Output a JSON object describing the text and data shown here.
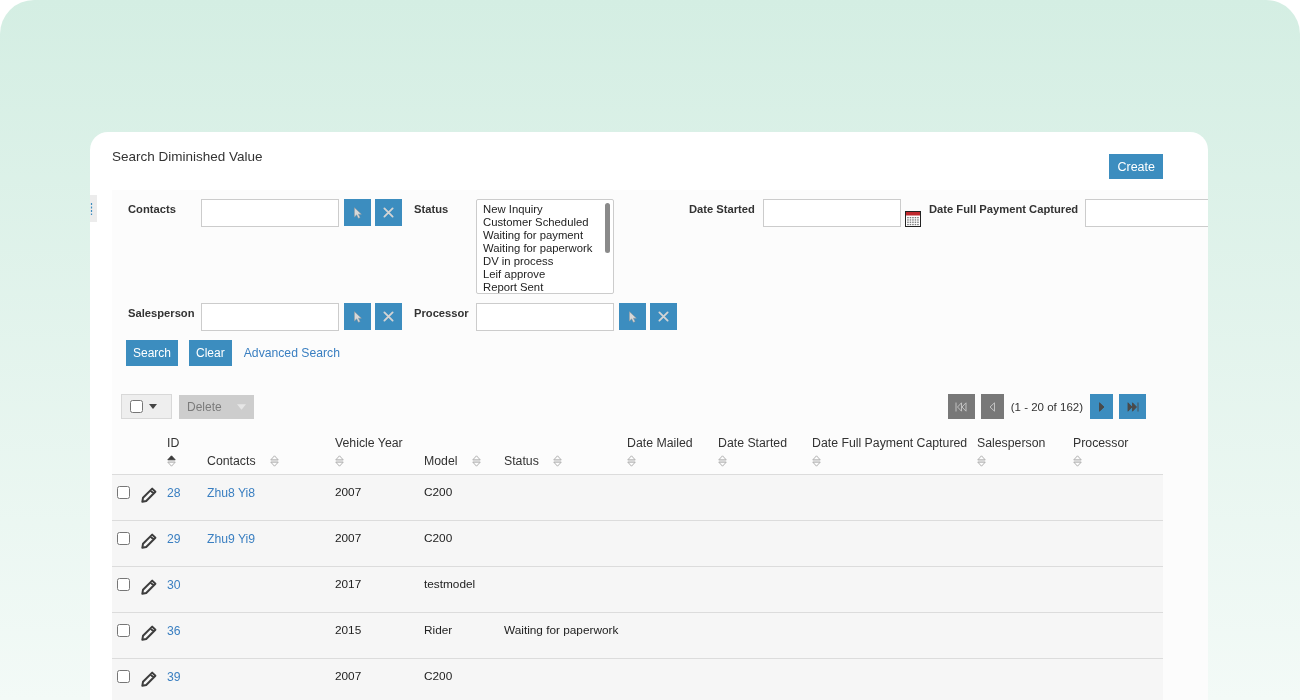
{
  "page": {
    "title": "Search Diminished Value",
    "create_button": {
      "label": "Create"
    }
  },
  "search_form": {
    "fields": [
      {
        "kind": "lookup",
        "label": "Contacts"
      },
      {
        "kind": "listbox",
        "label": "Status",
        "options": [
          {
            "label": "New Inquiry",
            "selected": false
          },
          {
            "label": "Customer Scheduled",
            "selected": false
          },
          {
            "label": "Waiting for payment",
            "selected": false
          },
          {
            "label": "Waiting for paperwork",
            "selected": false
          },
          {
            "label": "DV in process",
            "selected": false
          },
          {
            "label": "Leif approve",
            "selected": false
          },
          {
            "label": "Report Sent",
            "selected": false
          }
        ]
      },
      {
        "kind": "date",
        "label": "Date Started"
      },
      {
        "kind": "text",
        "label": "Date Full Payment Captured"
      },
      {
        "kind": "lookup",
        "label": "Salesperson"
      },
      {
        "kind": "lookup",
        "label": "Processor"
      }
    ],
    "actions": [
      {
        "kind": "button",
        "label": "Search"
      },
      {
        "kind": "button",
        "label": "Clear"
      },
      {
        "kind": "link",
        "label": "Advanced Search"
      }
    ]
  },
  "toolbar": {
    "select_all": {
      "checked": false
    },
    "delete_button": {
      "label": "Delete",
      "disabled": true
    },
    "pagination": [
      {
        "kind": "first",
        "disabled": true
      },
      {
        "kind": "prev",
        "disabled": true
      },
      {
        "kind": "summary",
        "text": "(1 - 20 of 162)"
      },
      {
        "kind": "next",
        "disabled": false
      },
      {
        "kind": "last",
        "disabled": false
      }
    ]
  },
  "table": {
    "columns": [
      {
        "label": "ID",
        "sorted": true
      },
      {
        "label": "Contacts",
        "sorted": false
      },
      {
        "label": "Vehicle Year",
        "sorted": false
      },
      {
        "label": "Model",
        "sorted": false
      },
      {
        "label": "Status",
        "sorted": false
      },
      {
        "label": "Date Mailed",
        "sorted": false
      },
      {
        "label": "Date Started",
        "sorted": false
      },
      {
        "label": "Date Full Payment Captured",
        "sorted": false
      },
      {
        "label": "Salesperson",
        "sorted": false
      },
      {
        "label": "Processor",
        "sorted": false
      }
    ],
    "rows": [
      {
        "checked": false,
        "id": "28",
        "contacts": "Zhu8 Yi8",
        "vehicle_year": "2007",
        "model": "C200"
      },
      {
        "checked": false,
        "id": "29",
        "contacts": "Zhu9 Yi9",
        "vehicle_year": "2007",
        "model": "C200"
      },
      {
        "checked": false,
        "id": "30",
        "vehicle_year": "2017",
        "model": "testmodel"
      },
      {
        "checked": false,
        "id": "36",
        "vehicle_year": "2015",
        "model": "Rider",
        "status": "Waiting for paperwork"
      },
      {
        "checked": false,
        "id": "39",
        "vehicle_year": "2007",
        "model": "C200"
      }
    ]
  }
}
